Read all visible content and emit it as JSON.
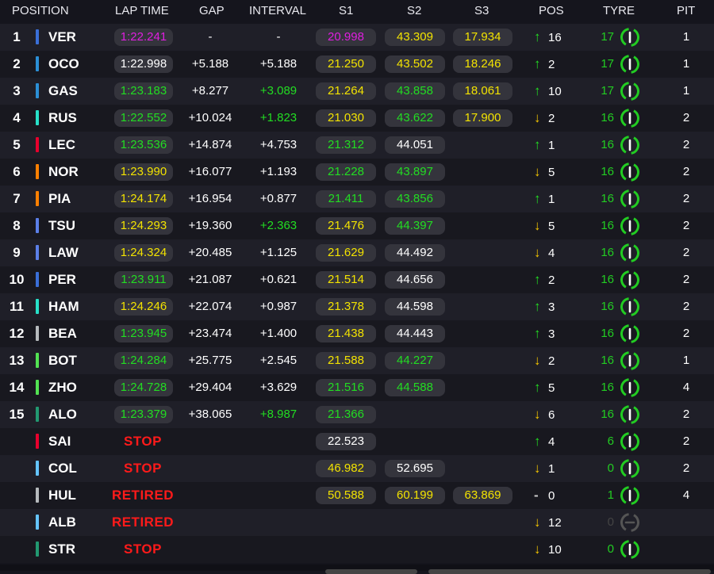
{
  "header": {
    "position": "POSITION",
    "lap_time": "LAP TIME",
    "gap": "GAP",
    "interval": "INTERVAL",
    "s1": "S1",
    "s2": "S2",
    "s3": "S3",
    "pos": "POS",
    "tyre": "TYRE",
    "pit": "PIT"
  },
  "colors": {
    "purple": "#e01ee0",
    "green": "#22dd22",
    "yellow": "#f3e300",
    "white": "#ffffff",
    "red": "#ff1a1a",
    "tyre_green": "#22cc22",
    "tyre_grey": "#555555"
  },
  "rows": [
    {
      "pos": "1",
      "code": "VER",
      "team_color": "#3a6fd8",
      "lap_time": "1:22.241",
      "lap_color": "purple",
      "gap": "-",
      "interval": "-",
      "interval_color": "white",
      "s1": "20.998",
      "s1_color": "purple",
      "s2": "43.309",
      "s2_color": "yellow",
      "s3": "17.934",
      "s3_color": "yellow",
      "arrow": "up",
      "pos_change": "16",
      "tyre_laps": "17",
      "tyre_icon": "tyre-hard-icon",
      "pit": "1"
    },
    {
      "pos": "2",
      "code": "OCO",
      "team_color": "#2b8fd6",
      "lap_time": "1:22.998",
      "lap_color": "white",
      "gap": "+5.188",
      "interval": "+5.188",
      "interval_color": "white",
      "s1": "21.250",
      "s1_color": "yellow",
      "s2": "43.502",
      "s2_color": "yellow",
      "s3": "18.246",
      "s3_color": "yellow",
      "arrow": "up",
      "pos_change": "2",
      "tyre_laps": "17",
      "tyre_icon": "tyre-hard-icon",
      "pit": "1"
    },
    {
      "pos": "3",
      "code": "GAS",
      "team_color": "#2b8fd6",
      "lap_time": "1:23.183",
      "lap_color": "green",
      "gap": "+8.277",
      "interval": "+3.089",
      "interval_color": "green",
      "s1": "21.264",
      "s1_color": "yellow",
      "s2": "43.858",
      "s2_color": "green",
      "s3": "18.061",
      "s3_color": "yellow",
      "arrow": "up",
      "pos_change": "10",
      "tyre_laps": "17",
      "tyre_icon": "tyre-hard-icon",
      "pit": "1"
    },
    {
      "pos": "4",
      "code": "RUS",
      "team_color": "#27e0c8",
      "lap_time": "1:22.552",
      "lap_color": "green",
      "gap": "+10.024",
      "interval": "+1.823",
      "interval_color": "green",
      "s1": "21.030",
      "s1_color": "yellow",
      "s2": "43.622",
      "s2_color": "green",
      "s3": "17.900",
      "s3_color": "yellow",
      "arrow": "down",
      "pos_change": "2",
      "tyre_laps": "16",
      "tyre_icon": "tyre-hard-icon",
      "pit": "2"
    },
    {
      "pos": "5",
      "code": "LEC",
      "team_color": "#e8002d",
      "lap_time": "1:23.536",
      "lap_color": "green",
      "gap": "+14.874",
      "interval": "+4.753",
      "interval_color": "white",
      "s1": "21.312",
      "s1_color": "green",
      "s2": "44.051",
      "s2_color": "white",
      "s3": "",
      "s3_color": "white",
      "arrow": "up",
      "pos_change": "1",
      "tyre_laps": "16",
      "tyre_icon": "tyre-hard-icon",
      "pit": "2"
    },
    {
      "pos": "6",
      "code": "NOR",
      "team_color": "#ff8000",
      "lap_time": "1:23.990",
      "lap_color": "yellow",
      "gap": "+16.077",
      "interval": "+1.193",
      "interval_color": "white",
      "s1": "21.228",
      "s1_color": "green",
      "s2": "43.897",
      "s2_color": "green",
      "s3": "",
      "s3_color": "white",
      "arrow": "down",
      "pos_change": "5",
      "tyre_laps": "16",
      "tyre_icon": "tyre-hard-icon",
      "pit": "2"
    },
    {
      "pos": "7",
      "code": "PIA",
      "team_color": "#ff8000",
      "lap_time": "1:24.174",
      "lap_color": "yellow",
      "gap": "+16.954",
      "interval": "+0.877",
      "interval_color": "white",
      "s1": "21.411",
      "s1_color": "green",
      "s2": "43.856",
      "s2_color": "green",
      "s3": "",
      "s3_color": "white",
      "arrow": "up",
      "pos_change": "1",
      "tyre_laps": "16",
      "tyre_icon": "tyre-hard-icon",
      "pit": "2"
    },
    {
      "pos": "8",
      "code": "TSU",
      "team_color": "#5b7fe8",
      "lap_time": "1:24.293",
      "lap_color": "yellow",
      "gap": "+19.360",
      "interval": "+2.363",
      "interval_color": "green",
      "s1": "21.476",
      "s1_color": "yellow",
      "s2": "44.397",
      "s2_color": "green",
      "s3": "",
      "s3_color": "white",
      "arrow": "down",
      "pos_change": "5",
      "tyre_laps": "16",
      "tyre_icon": "tyre-hard-icon",
      "pit": "2"
    },
    {
      "pos": "9",
      "code": "LAW",
      "team_color": "#5b7fe8",
      "lap_time": "1:24.324",
      "lap_color": "yellow",
      "gap": "+20.485",
      "interval": "+1.125",
      "interval_color": "white",
      "s1": "21.629",
      "s1_color": "yellow",
      "s2": "44.492",
      "s2_color": "white",
      "s3": "",
      "s3_color": "white",
      "arrow": "down",
      "pos_change": "4",
      "tyre_laps": "16",
      "tyre_icon": "tyre-hard-icon",
      "pit": "2"
    },
    {
      "pos": "10",
      "code": "PER",
      "team_color": "#3a6fd8",
      "lap_time": "1:23.911",
      "lap_color": "green",
      "gap": "+21.087",
      "interval": "+0.621",
      "interval_color": "white",
      "s1": "21.514",
      "s1_color": "yellow",
      "s2": "44.656",
      "s2_color": "white",
      "s3": "",
      "s3_color": "white",
      "arrow": "up",
      "pos_change": "2",
      "tyre_laps": "16",
      "tyre_icon": "tyre-hard-icon",
      "pit": "2"
    },
    {
      "pos": "11",
      "code": "HAM",
      "team_color": "#27e0c8",
      "lap_time": "1:24.246",
      "lap_color": "yellow",
      "gap": "+22.074",
      "interval": "+0.987",
      "interval_color": "white",
      "s1": "21.378",
      "s1_color": "yellow",
      "s2": "44.598",
      "s2_color": "white",
      "s3": "",
      "s3_color": "white",
      "arrow": "up",
      "pos_change": "3",
      "tyre_laps": "16",
      "tyre_icon": "tyre-hard-icon",
      "pit": "2"
    },
    {
      "pos": "12",
      "code": "BEA",
      "team_color": "#b6babd",
      "lap_time": "1:23.945",
      "lap_color": "green",
      "gap": "+23.474",
      "interval": "+1.400",
      "interval_color": "white",
      "s1": "21.438",
      "s1_color": "yellow",
      "s2": "44.443",
      "s2_color": "white",
      "s3": "",
      "s3_color": "white",
      "arrow": "up",
      "pos_change": "3",
      "tyre_laps": "16",
      "tyre_icon": "tyre-hard-icon",
      "pit": "2"
    },
    {
      "pos": "13",
      "code": "BOT",
      "team_color": "#52e252",
      "lap_time": "1:24.284",
      "lap_color": "green",
      "gap": "+25.775",
      "interval": "+2.545",
      "interval_color": "white",
      "s1": "21.588",
      "s1_color": "yellow",
      "s2": "44.227",
      "s2_color": "green",
      "s3": "",
      "s3_color": "white",
      "arrow": "down",
      "pos_change": "2",
      "tyre_laps": "16",
      "tyre_icon": "tyre-hard-icon",
      "pit": "1"
    },
    {
      "pos": "14",
      "code": "ZHO",
      "team_color": "#52e252",
      "lap_time": "1:24.728",
      "lap_color": "green",
      "gap": "+29.404",
      "interval": "+3.629",
      "interval_color": "white",
      "s1": "21.516",
      "s1_color": "green",
      "s2": "44.588",
      "s2_color": "green",
      "s3": "",
      "s3_color": "white",
      "arrow": "up",
      "pos_change": "5",
      "tyre_laps": "16",
      "tyre_icon": "tyre-hard-icon",
      "pit": "4"
    },
    {
      "pos": "15",
      "code": "ALO",
      "team_color": "#229971",
      "lap_time": "1:23.379",
      "lap_color": "green",
      "gap": "+38.065",
      "interval": "+8.987",
      "interval_color": "green",
      "s1": "21.366",
      "s1_color": "green",
      "s2": "",
      "s2_color": "white",
      "s3": "",
      "s3_color": "white",
      "arrow": "down",
      "pos_change": "6",
      "tyre_laps": "16",
      "tyre_icon": "tyre-hard-icon",
      "pit": "2"
    },
    {
      "pos": "",
      "code": "SAI",
      "team_color": "#e8002d",
      "status": "STOP",
      "gap": "",
      "interval": "",
      "interval_color": "white",
      "s1": "22.523",
      "s1_color": "white",
      "s2": "",
      "s2_color": "white",
      "s3": "",
      "s3_color": "white",
      "arrow": "up",
      "pos_change": "4",
      "tyre_laps": "6",
      "tyre_icon": "tyre-hard-icon",
      "pit": "2"
    },
    {
      "pos": "",
      "code": "COL",
      "team_color": "#64c4ff",
      "status": "STOP",
      "gap": "",
      "interval": "",
      "interval_color": "white",
      "s1": "46.982",
      "s1_color": "yellow",
      "s2": "52.695",
      "s2_color": "white",
      "s3": "",
      "s3_color": "white",
      "arrow": "down",
      "pos_change": "1",
      "tyre_laps": "0",
      "tyre_icon": "tyre-hard-icon",
      "pit": "2"
    },
    {
      "pos": "",
      "code": "HUL",
      "team_color": "#b6babd",
      "status": "RETIRED",
      "gap": "",
      "interval": "",
      "interval_color": "white",
      "s1": "50.588",
      "s1_color": "yellow",
      "s2": "60.199",
      "s2_color": "yellow",
      "s3": "63.869",
      "s3_color": "yellow",
      "arrow": "none",
      "pos_change": "0",
      "tyre_laps": "1",
      "tyre_icon": "tyre-hard-icon",
      "pit": "4"
    },
    {
      "pos": "",
      "code": "ALB",
      "team_color": "#64c4ff",
      "status": "RETIRED",
      "gap": "",
      "interval": "",
      "interval_color": "white",
      "s1": "",
      "s1_color": "white",
      "s2": "",
      "s2_color": "white",
      "s3": "",
      "s3_color": "white",
      "arrow": "down",
      "pos_change": "12",
      "tyre_laps": "0",
      "tyre_icon": "tyre-unknown-icon",
      "pit": ""
    },
    {
      "pos": "",
      "code": "STR",
      "team_color": "#229971",
      "status": "STOP",
      "gap": "",
      "interval": "",
      "interval_color": "white",
      "s1": "",
      "s1_color": "white",
      "s2": "",
      "s2_color": "white",
      "s3": "",
      "s3_color": "white",
      "arrow": "down",
      "pos_change": "10",
      "tyre_laps": "0",
      "tyre_icon": "tyre-hard-icon",
      "pit": ""
    }
  ]
}
